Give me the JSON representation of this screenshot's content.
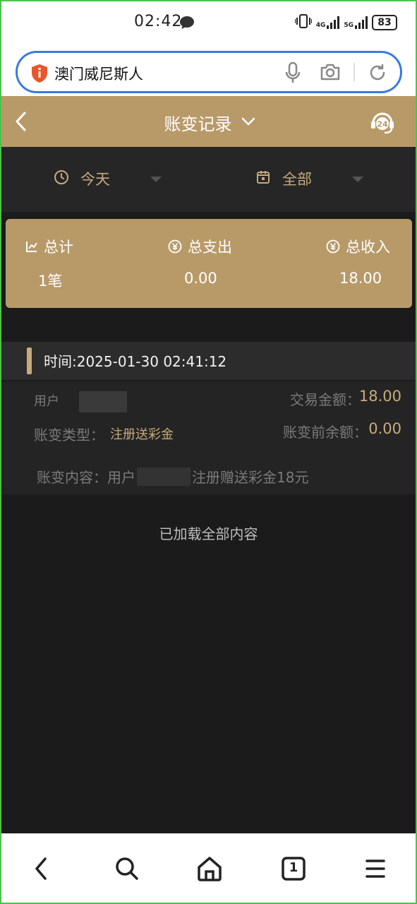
{
  "status_bar": {
    "time": "02:42",
    "network_4g": "4G",
    "network_5g": "5G",
    "battery": "83"
  },
  "browser": {
    "url_text": "澳门威尼斯人"
  },
  "header": {
    "title": "账变记录"
  },
  "filters": {
    "date": "今天",
    "category": "全部"
  },
  "summary": {
    "total_label": "总计",
    "expense_label": "总支出",
    "income_label": "总收入",
    "total_value": "1笔",
    "expense_value": "0.00",
    "income_value": "18.00"
  },
  "record": {
    "time": "时间:2025-01-30 02:41:12",
    "user_label": "用户",
    "type_label": "账变类型：",
    "type_value": "注册送彩金",
    "amount_label": "交易金额：",
    "amount_value": "18.00",
    "pre_balance_label": "账变前余额：",
    "pre_balance_value": "0.00",
    "content_prefix": "账变内容：用户",
    "content_suffix": "注册赠送彩金18元"
  },
  "footer": {
    "loaded_text": "已加载全部内容"
  },
  "bottom_nav": {
    "tab_count": "1"
  },
  "colors": {
    "gold": "#b89a69",
    "gold_text": "#c7ab7c",
    "background": "#1b1b1b",
    "url_border": "#3a7bde"
  }
}
